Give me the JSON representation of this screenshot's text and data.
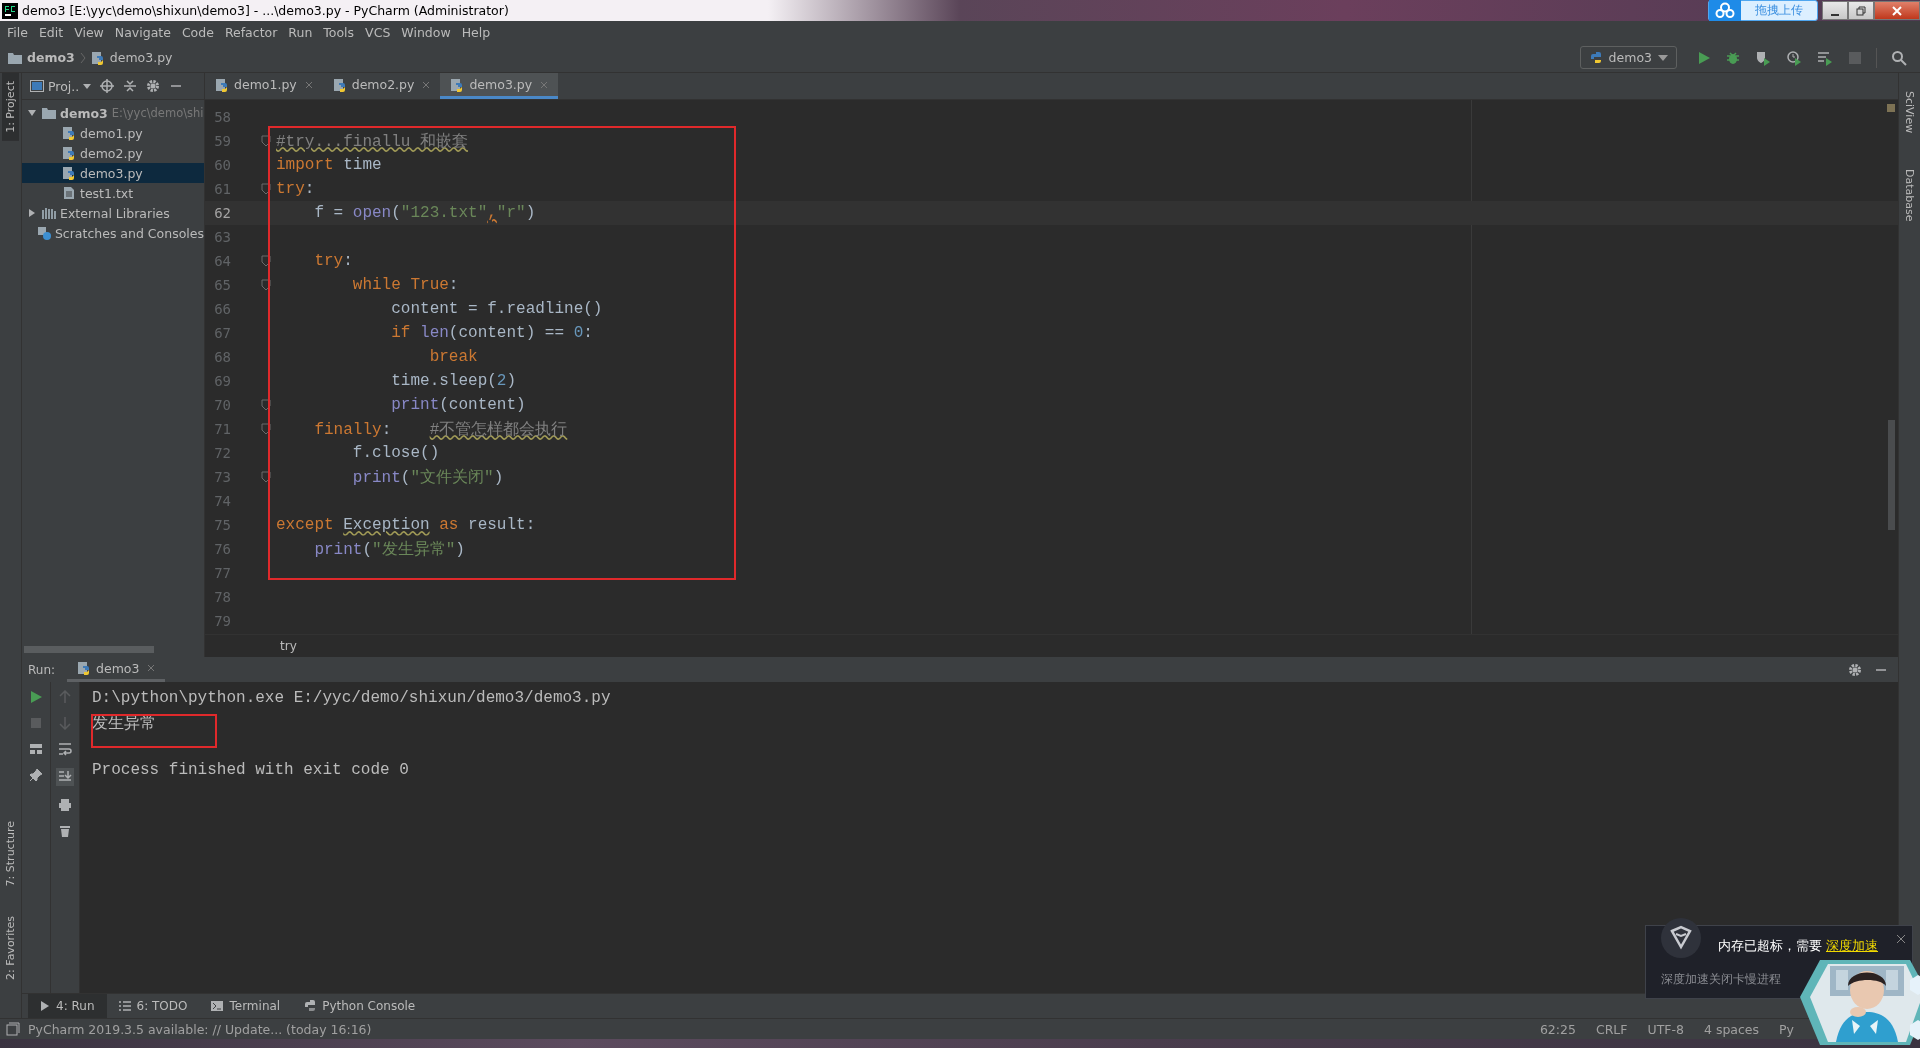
{
  "window": {
    "title": "demo3 [E:\\yyc\\demo\\shixun\\demo3] - ...\\demo3.py - PyCharm (Administrator)",
    "upload_button": "拖拽上传"
  },
  "menu": [
    "File",
    "Edit",
    "View",
    "Navigate",
    "Code",
    "Refactor",
    "Run",
    "Tools",
    "VCS",
    "Window",
    "Help"
  ],
  "navigation": {
    "breadcrumbs": [
      "demo3",
      "demo3.py"
    ],
    "run_config": "demo3"
  },
  "left_strip": {
    "top": [
      {
        "label": "1: Project",
        "selected": true
      }
    ],
    "bottom": [
      {
        "label": "7: Structure",
        "selected": false
      },
      {
        "label": "2: Favorites",
        "selected": false
      }
    ]
  },
  "right_strip": [
    "SciView",
    "Database"
  ],
  "project": {
    "title": "Proj..",
    "tree": [
      {
        "label": "demo3",
        "path": "E:\\yyc\\demo\\shi",
        "kind": "folder",
        "expanded": true,
        "selected": false,
        "children": [
          {
            "label": "demo1.py",
            "kind": "python",
            "selected": false
          },
          {
            "label": "demo2.py",
            "kind": "python",
            "selected": false
          },
          {
            "label": "demo3.py",
            "kind": "python",
            "selected": true
          },
          {
            "label": "test1.txt",
            "kind": "text",
            "selected": false
          }
        ]
      },
      {
        "label": "External Libraries",
        "kind": "library",
        "expanded": false,
        "selected": false
      },
      {
        "label": "Scratches and Consoles",
        "kind": "scratch",
        "selected": false
      }
    ]
  },
  "editor": {
    "tabs": [
      {
        "label": "demo1.py",
        "selected": false
      },
      {
        "label": "demo2.py",
        "selected": false
      },
      {
        "label": "demo3.py",
        "selected": true
      }
    ],
    "lines": [
      {
        "number": "58",
        "current": false,
        "fold": false
      },
      {
        "number": "59",
        "current": false,
        "fold": true,
        "tokens": [
          {
            "text": "#try...finallu 和嵌套",
            "kind": "comment"
          }
        ]
      },
      {
        "number": "60",
        "current": false,
        "fold": false,
        "tokens": [
          {
            "text": "import",
            "kind": "keyword"
          },
          {
            "text": " time",
            "kind": "plain"
          }
        ]
      },
      {
        "number": "61",
        "current": false,
        "fold": true,
        "tokens": [
          {
            "text": "try",
            "kind": "keyword"
          },
          {
            "text": ":",
            "kind": "plain"
          }
        ]
      },
      {
        "number": "62",
        "current": true,
        "fold": false,
        "tokens": [
          {
            "text": "    f = ",
            "kind": "plain"
          },
          {
            "text": "open",
            "kind": "builtin"
          },
          {
            "text": "(",
            "kind": "plain"
          },
          {
            "text": "\"123.txt\"",
            "kind": "string"
          },
          {
            "text": ",",
            "kind": "warning"
          },
          {
            "text": "\"r\"",
            "kind": "string"
          },
          {
            "text": ")",
            "kind": "plain"
          }
        ]
      },
      {
        "number": "63",
        "current": false,
        "fold": false
      },
      {
        "number": "64",
        "current": false,
        "fold": true,
        "tokens": [
          {
            "text": "    try",
            "kind": "keyword"
          },
          {
            "text": ":",
            "kind": "plain"
          }
        ]
      },
      {
        "number": "65",
        "current": false,
        "fold": true,
        "tokens": [
          {
            "text": "        while True",
            "kind": "keyword"
          },
          {
            "text": ":",
            "kind": "plain"
          }
        ]
      },
      {
        "number": "66",
        "current": false,
        "fold": false,
        "tokens": [
          {
            "text": "            content = f.readline()",
            "kind": "plain"
          }
        ]
      },
      {
        "number": "67",
        "current": false,
        "fold": false,
        "tokens": [
          {
            "text": "            if ",
            "kind": "keyword"
          },
          {
            "text": "len",
            "kind": "builtin"
          },
          {
            "text": "(content) == ",
            "kind": "plain"
          },
          {
            "text": "0",
            "kind": "number"
          },
          {
            "text": ":",
            "kind": "plain"
          }
        ]
      },
      {
        "number": "68",
        "current": false,
        "fold": false,
        "tokens": [
          {
            "text": "                break",
            "kind": "keyword"
          }
        ]
      },
      {
        "number": "69",
        "current": false,
        "fold": false,
        "tokens": [
          {
            "text": "            time.sleep(",
            "kind": "plain"
          },
          {
            "text": "2",
            "kind": "number"
          },
          {
            "text": ")",
            "kind": "plain"
          }
        ]
      },
      {
        "number": "70",
        "current": false,
        "fold": true,
        "tokens": [
          {
            "text": "            print",
            "kind": "builtin"
          },
          {
            "text": "(content)",
            "kind": "plain"
          }
        ]
      },
      {
        "number": "71",
        "current": false,
        "fold": true,
        "tokens": [
          {
            "text": "    finally",
            "kind": "keyword"
          },
          {
            "text": ":    ",
            "kind": "plain"
          },
          {
            "text": "#不管怎样都会执行",
            "kind": "comment"
          }
        ]
      },
      {
        "number": "72",
        "current": false,
        "fold": false,
        "tokens": [
          {
            "text": "        f.close()",
            "kind": "plain"
          }
        ]
      },
      {
        "number": "73",
        "current": false,
        "fold": true,
        "tokens": [
          {
            "text": "        print",
            "kind": "builtin"
          },
          {
            "text": "(",
            "kind": "plain"
          },
          {
            "text": "\"文件关闭\"",
            "kind": "string"
          },
          {
            "text": ")",
            "kind": "plain"
          }
        ]
      },
      {
        "number": "74",
        "current": false,
        "fold": false
      },
      {
        "number": "75",
        "current": false,
        "fold": false,
        "tokens": [
          {
            "text": "except ",
            "kind": "keyword"
          },
          {
            "text": "Exception",
            "kind": "class_ref"
          },
          {
            "text": " as",
            "kind": "keyword"
          },
          {
            "text": " result:",
            "kind": "plain"
          }
        ]
      },
      {
        "number": "76",
        "current": false,
        "fold": false,
        "tokens": [
          {
            "text": "    print",
            "kind": "builtin"
          },
          {
            "text": "(",
            "kind": "plain"
          },
          {
            "text": "\"发生异常\"",
            "kind": "string"
          },
          {
            "text": ")",
            "kind": "plain"
          }
        ]
      },
      {
        "number": "77",
        "current": false,
        "fold": false
      },
      {
        "number": "78",
        "current": false,
        "fold": false
      },
      {
        "number": "79",
        "current": false,
        "fold": false
      }
    ],
    "breadcrumb": "try"
  },
  "run": {
    "label": "Run:",
    "tab": "demo3",
    "output": [
      {
        "text": "D:\\python\\python.exe E:/yyc/demo/shixun/demo3/demo3.py",
        "kind": "command"
      },
      {
        "text": "发生异常",
        "kind": "stdout"
      },
      {
        "text": "Process finished with exit code 0",
        "kind": "exit"
      }
    ]
  },
  "bottom_tabs": [
    {
      "label": "4: Run",
      "kind": "run",
      "selected": true
    },
    {
      "label": "6: TODO",
      "kind": "todo",
      "selected": false
    },
    {
      "label": "Terminal",
      "kind": "terminal",
      "selected": false
    },
    {
      "label": "Python Console",
      "kind": "console",
      "selected": false
    }
  ],
  "status_bar": {
    "message": "PyCharm 2019.3.5 available: // Update... (today 16:16)",
    "items": [
      "62:25",
      "CRLF",
      "UTF-8",
      "4 spaces",
      "Py"
    ]
  },
  "notification": {
    "message": "内存已超标，需要",
    "link": "深度加速",
    "detail": "深度加速关闭卡慢进程"
  }
}
